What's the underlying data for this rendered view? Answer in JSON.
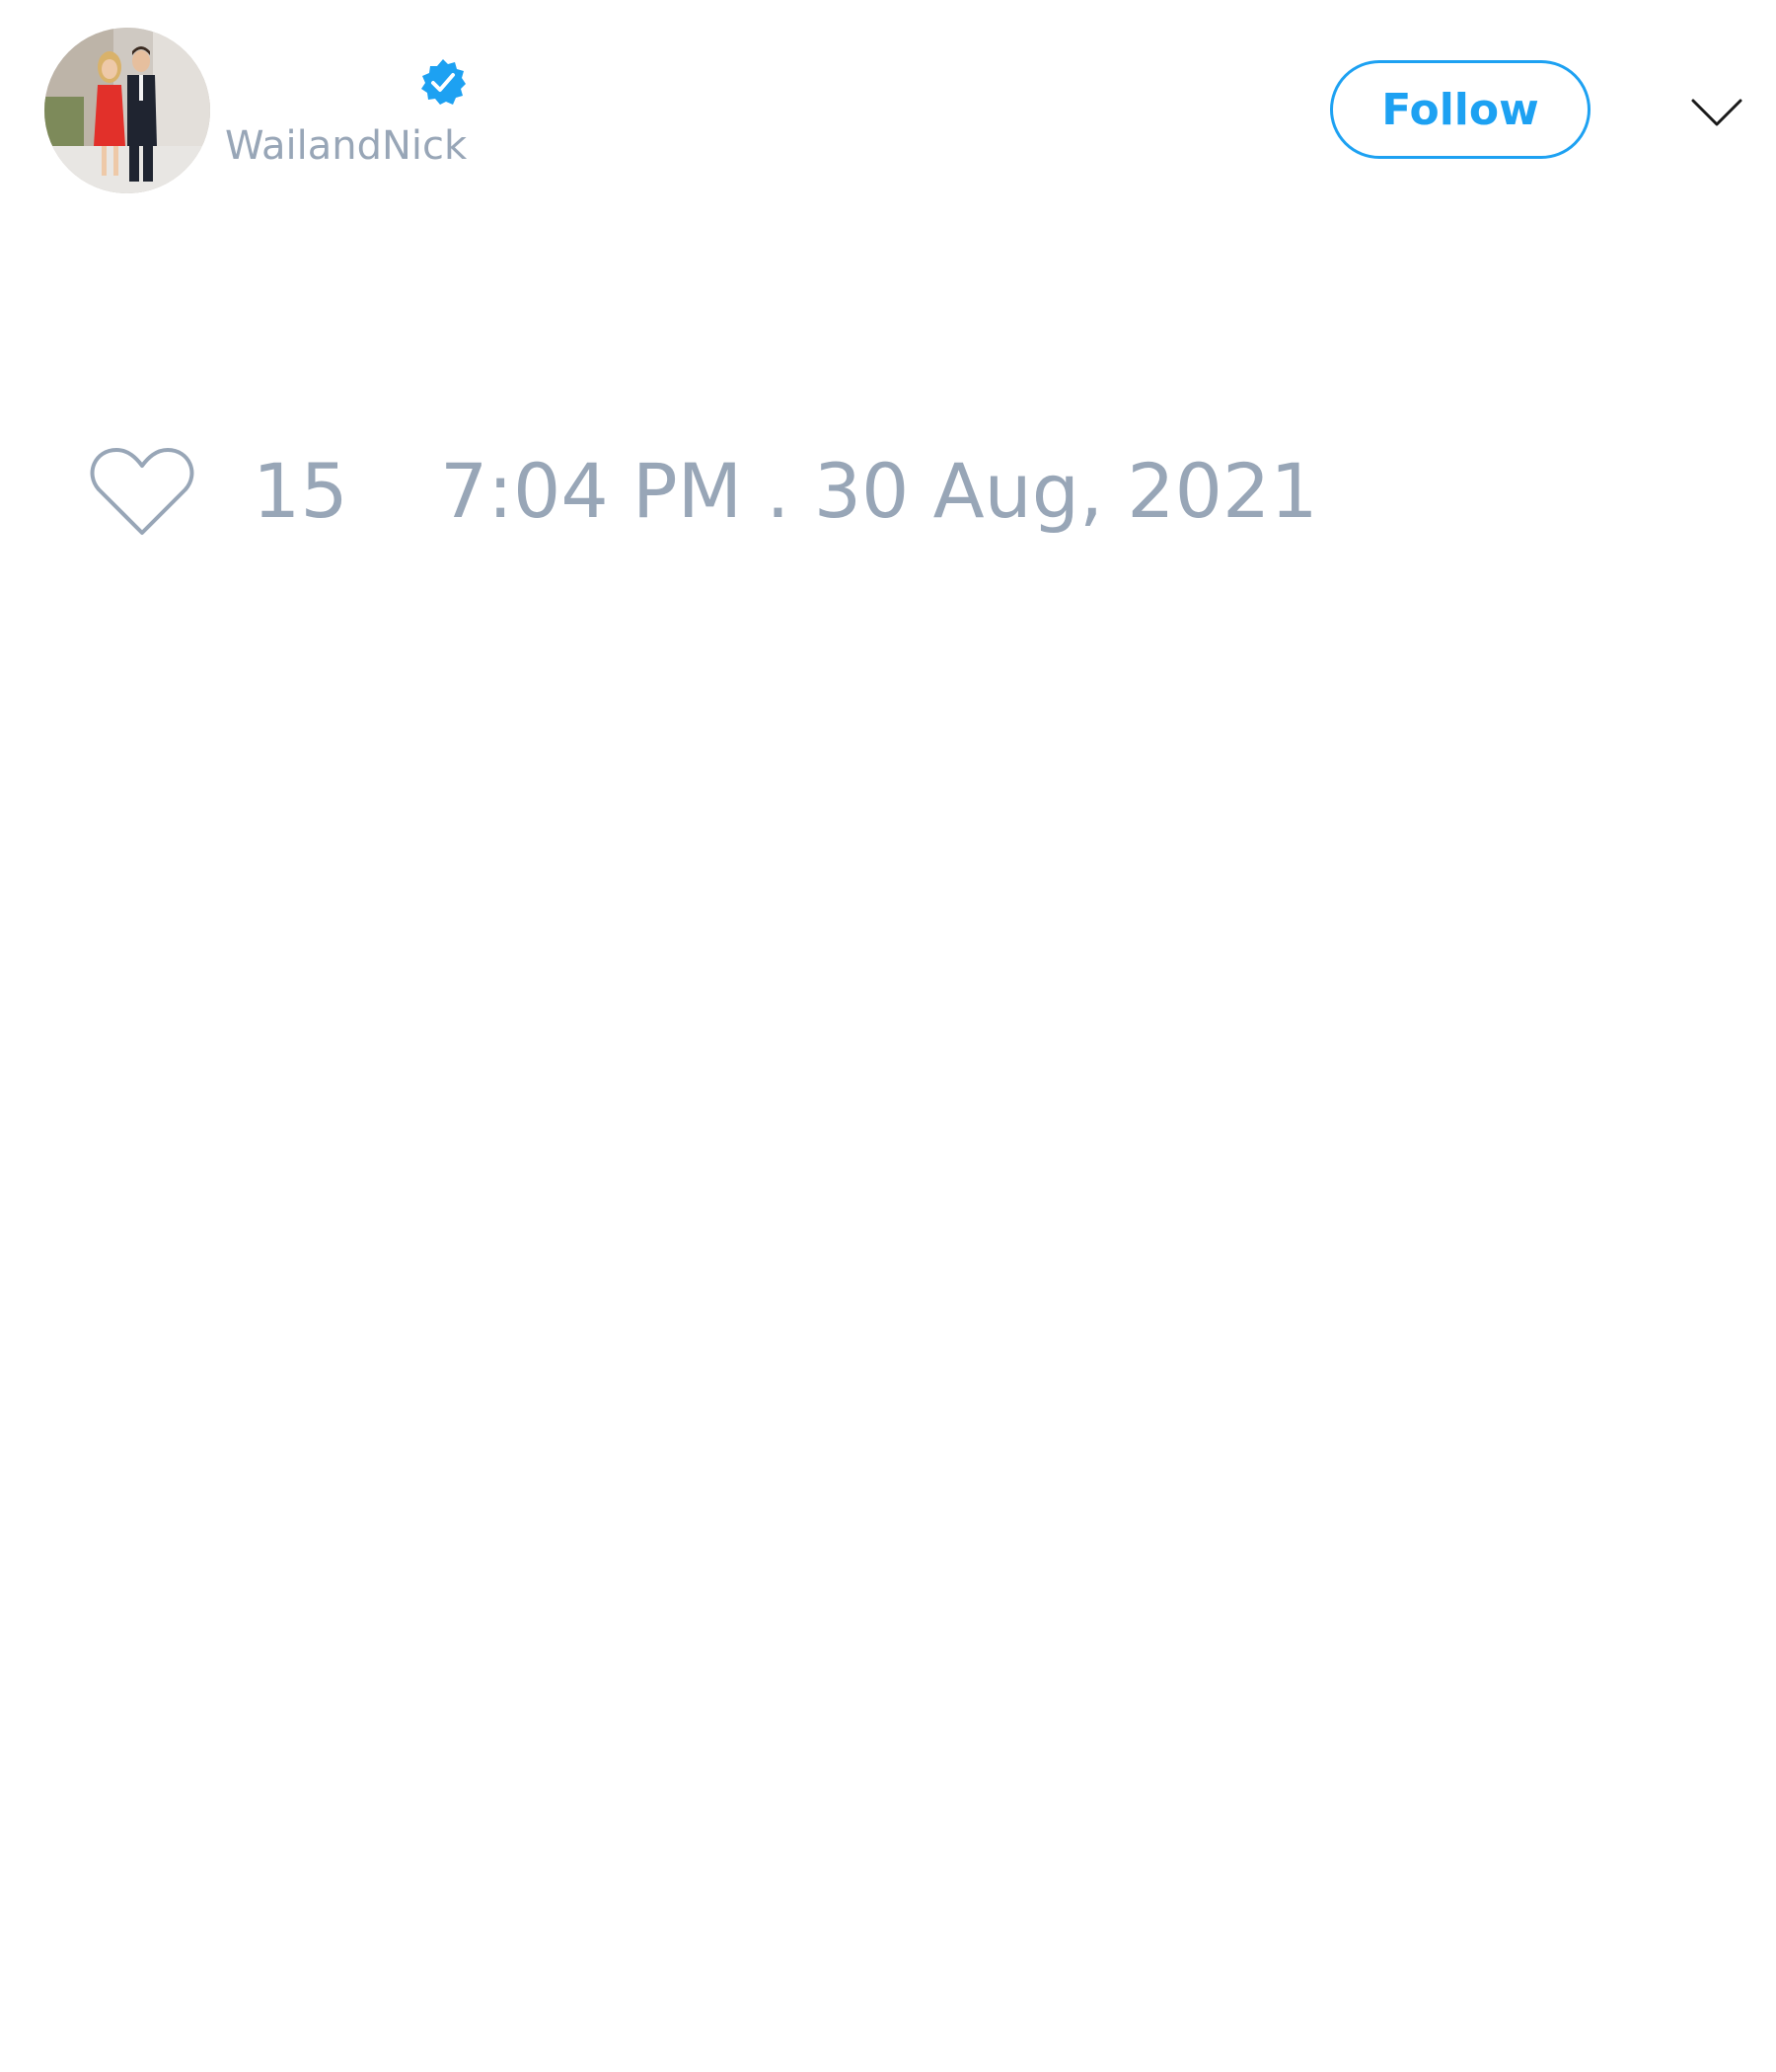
{
  "header": {
    "avatar_alt": "profile photo",
    "handle": "WailandNick",
    "verified": true,
    "follow_label": "Follow",
    "more_icon": "chevron-down-icon"
  },
  "actions": {
    "like_icon": "heart-icon",
    "like_count": "15",
    "timestamp": "7:04 PM . 30 Aug, 2021"
  },
  "colors": {
    "accent": "#1da1f2",
    "muted_text": "#98a6b7",
    "background": "#ffffff"
  }
}
